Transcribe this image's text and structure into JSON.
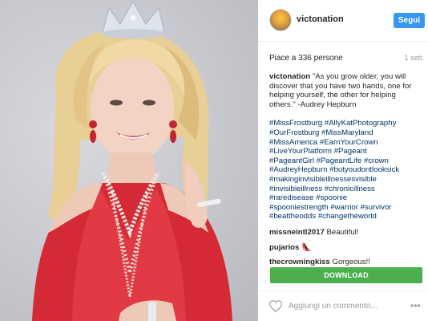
{
  "header": {
    "username": "victonation",
    "follow_label": "Segui"
  },
  "meta": {
    "likes_text": "Piace a 336 persone",
    "date": "1 sett."
  },
  "caption": {
    "user": "victonation",
    "text": "\"As you grow older, you will discover that you have two hands, one for helping yourself, the other for helping others.\" -Audrey Hepburn"
  },
  "hashtags": [
    "#MissFrostburg #AllyKatPhotography",
    "#OurFrostburg #MissMaryland",
    "#MissAmerica #EarnYourCrown",
    "#LiveYourPlatform #Pageant",
    "#PageantGirl #PageantLife #crown",
    "#AudreyHepburn #butyoudontlooksick",
    "#makinginvisibleillnessesvisible",
    "#invisibleillness #chronicillness",
    "#raredisease #spoonie",
    "#spooniestrength #warrior #survivor",
    "#beattheodds #changetheworld"
  ],
  "comments": [
    {
      "user": "missneintl2017",
      "text": "Beautiful!"
    },
    {
      "user": "pujarios",
      "text": "👠"
    },
    {
      "user": "thecrowningkiss",
      "text": "Gorgeous!!"
    }
  ],
  "download_label": "DOWNLOAD",
  "footer": {
    "add_comment_placeholder": "Aggiungi un commento...",
    "more_glyph": "•••"
  }
}
